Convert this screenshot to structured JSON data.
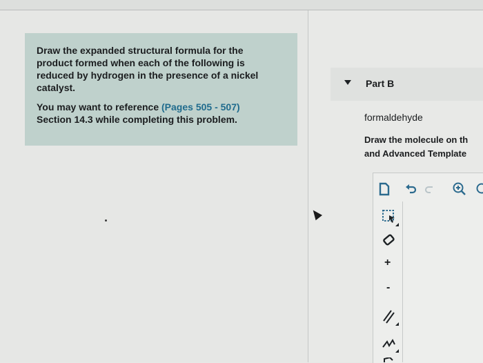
{
  "instructions": {
    "main": "Draw the expanded structural formula for the product formed when each of the following is reduced by hydrogen in the presence of a nickel catalyst.",
    "reference_prefix": "You may want to reference ",
    "reference_link": "(Pages 505 - 507)",
    "reference_suffix": "Section 14.3 while completing this problem."
  },
  "part": {
    "title": "Part B",
    "compound": "formaldehyde",
    "draw_instructions_line1": "Draw the molecule on th",
    "draw_instructions_line2": "and Advanced Template"
  },
  "toolbar": {
    "top_icons": [
      "new-document-icon",
      "undo-icon",
      "redo-icon",
      "zoom-in-icon",
      "zoom-out-icon"
    ],
    "side_icons": [
      "select-icon",
      "eraser-icon",
      "plus-charge-icon",
      "minus-charge-icon",
      "double-bond-icon",
      "chain-icon"
    ],
    "plus_symbol": "+",
    "minus_symbol": "-"
  },
  "colors": {
    "instructions_bg": "#bfd1cc",
    "link": "#1f6b8d",
    "toolbar_icon": "#2b6a8e"
  }
}
